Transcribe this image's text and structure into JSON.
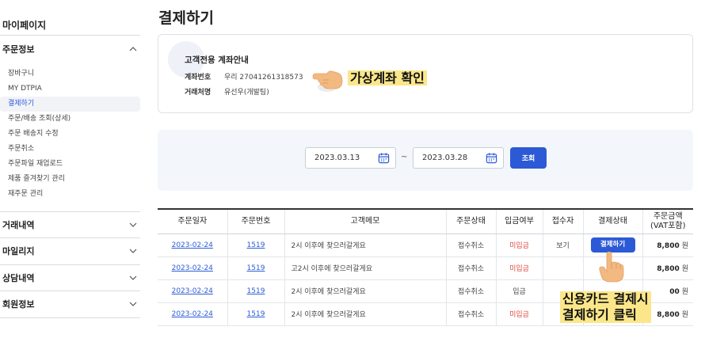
{
  "sidebar": {
    "title": "마이페이지",
    "sections": [
      {
        "label": "주문정보",
        "expanded": true
      },
      {
        "label": "거래내역",
        "expanded": false
      },
      {
        "label": "마일리지",
        "expanded": false
      },
      {
        "label": "상담내역",
        "expanded": false
      },
      {
        "label": "회원정보",
        "expanded": false
      }
    ],
    "items": [
      {
        "label": "장바구니"
      },
      {
        "label": "MY DTPIA"
      },
      {
        "label": "결제하기",
        "active": true
      },
      {
        "label": "주문/배송 조회(상세)"
      },
      {
        "label": "주문 배송지 수정"
      },
      {
        "label": "주문취소"
      },
      {
        "label": "주문파일 재업로드"
      },
      {
        "label": "제품 즐겨찾기 관리"
      },
      {
        "label": "재주문 관리"
      }
    ]
  },
  "page": {
    "title": "결제하기"
  },
  "account": {
    "title": "고객전용 계좌안내",
    "rows": [
      {
        "key": "계좌번호",
        "value": "우리 27041261318573"
      },
      {
        "key": "거래처명",
        "value": "유선우(개발팀)"
      }
    ]
  },
  "callouts": {
    "virtual_account": "가상계좌 확인",
    "card_line1": "신용카드 결제시",
    "card_line2": "결제하기 클릭"
  },
  "search": {
    "start_date": "2023.03.13",
    "separator": "~",
    "end_date": "2023.03.28",
    "button_label": "조회"
  },
  "table": {
    "headers": [
      "주문일자",
      "주문번호",
      "고객메모",
      "주문상태",
      "입금여부",
      "접수자",
      "결제상태",
      "주문금액\n(VAT포함)"
    ],
    "rows": [
      {
        "date": "2023-02-24",
        "order_no": "1519",
        "memo": "2시 이후에 찾으러갈게요",
        "status": "접수취소",
        "deposit": "미입금",
        "receiver": "보기",
        "pay_label": "결제하기",
        "amount": "8,800",
        "unit": "원"
      },
      {
        "date": "2023-02-24",
        "order_no": "1519",
        "memo": "고2시 이후에 찾으러갈게요",
        "status": "접수취소",
        "deposit": "미입금",
        "receiver": "",
        "pay_label": "",
        "amount": "8,800",
        "unit": "원"
      },
      {
        "date": "2023-02-24",
        "order_no": "1519",
        "memo": "2시 이후에 찾으러갈게요",
        "status": "접수취소",
        "deposit": "입금",
        "receiver": "",
        "pay_label": "",
        "amount": "00",
        "unit": "원"
      },
      {
        "date": "2023-02-24",
        "order_no": "1519",
        "memo": "2시 이후에 찾으러갈게요",
        "status": "접수취소",
        "deposit": "미입금",
        "receiver": "",
        "pay_label": "",
        "amount": "8,800",
        "unit": "원"
      }
    ]
  },
  "colors": {
    "accent": "#2c5ad6",
    "unpaid": "#e0463f",
    "highlight": "#fbe78a"
  },
  "icons": {
    "chevron": "chevron-icon",
    "calendar": "calendar-icon",
    "hand": "pointing-hand-icon"
  }
}
